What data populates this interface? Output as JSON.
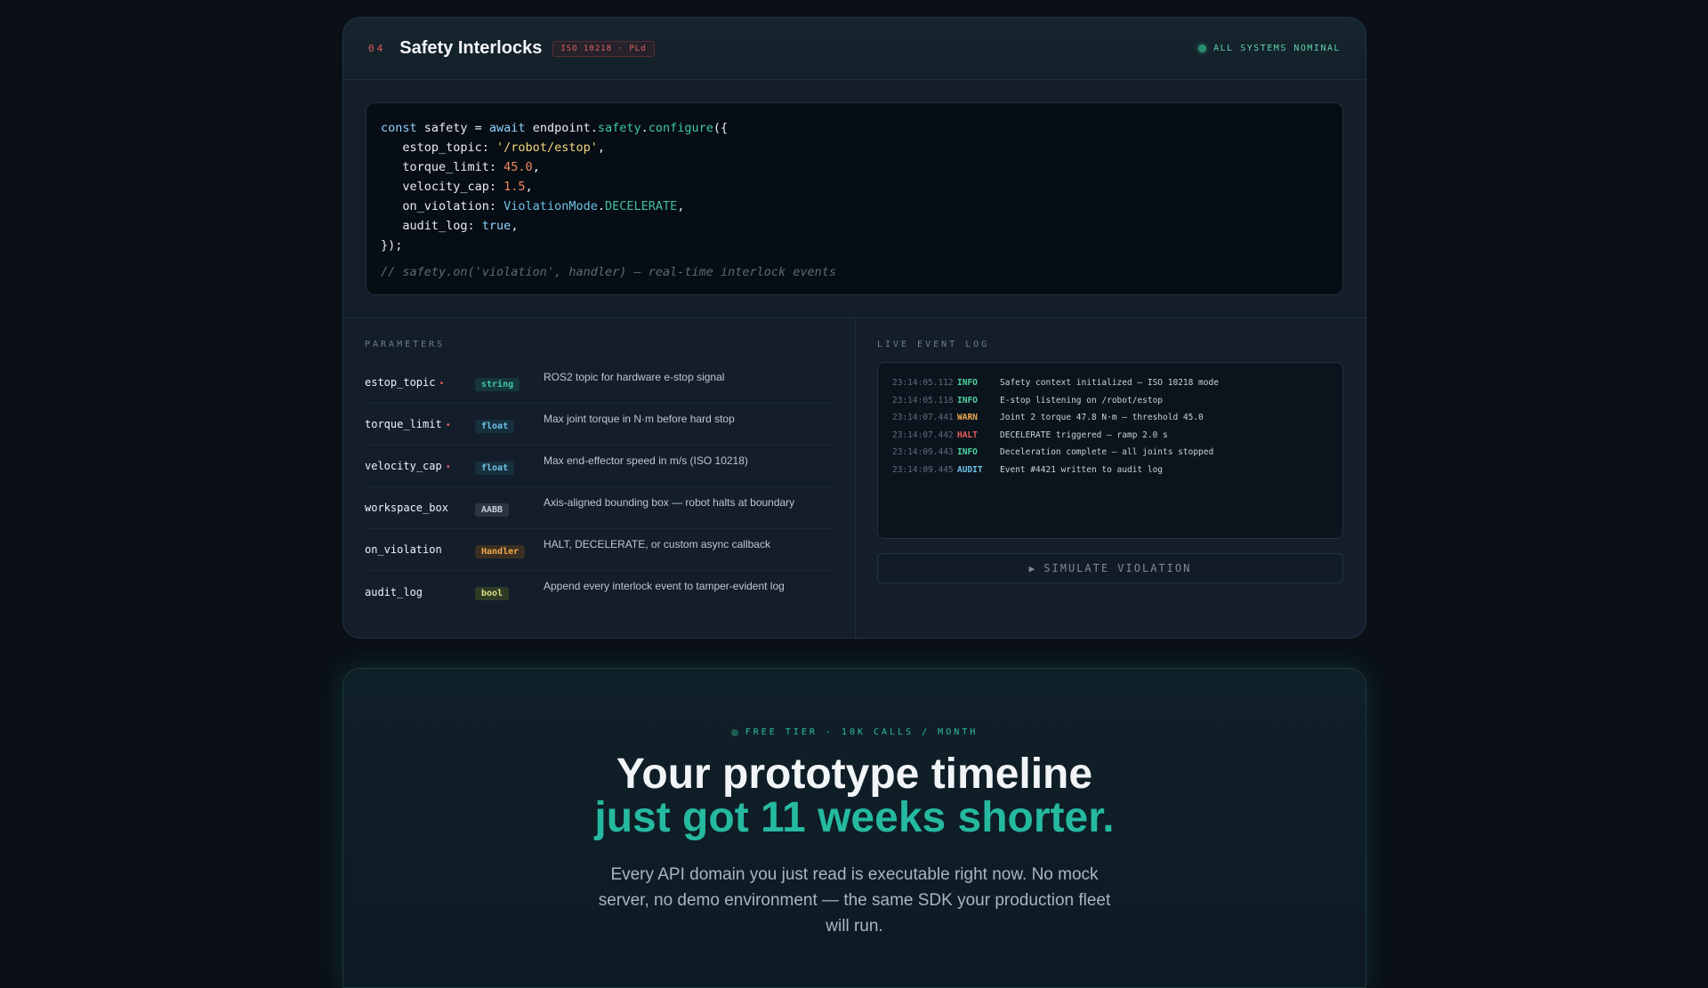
{
  "header": {
    "section_number": "04",
    "title": "Safety Interlocks",
    "badge": "ISO 10218 · PLd",
    "status": "ALL SYSTEMS NOMINAL",
    "status_color": "#2a8f6c"
  },
  "code": {
    "line1": {
      "kw": "const",
      "var": " safety = ",
      "await": "await",
      "obj": " endpoint.",
      "ns": "safety",
      "dot": ".",
      "fn": "configure",
      "tail": "({"
    },
    "line2": {
      "key": "   estop_topic: ",
      "val": "'/robot/estop'",
      "tail": ","
    },
    "line3": {
      "key": "   torque_limit: ",
      "val": "45.0",
      "tail": ","
    },
    "line4": {
      "key": "   velocity_cap: ",
      "val": "1.5",
      "tail": ","
    },
    "line5": {
      "key": "   on_violation: ",
      "cls": "ViolationMode",
      "dot": ".",
      "enm": "DECELERATE",
      "tail": ","
    },
    "line6": {
      "key": "   audit_log: ",
      "val": "true",
      "tail": ","
    },
    "line7": "});",
    "comment": "// safety.on('violation', handler) — real-time interlock events"
  },
  "parameters": {
    "label": "PARAMETERS",
    "required_marker": "•",
    "rows": [
      {
        "name": "estop_topic",
        "required": true,
        "type": "string",
        "desc": "ROS2 topic for hardware e-stop signal"
      },
      {
        "name": "torque_limit",
        "required": true,
        "type": "float",
        "desc": "Max joint torque in N·m before hard stop"
      },
      {
        "name": "velocity_cap",
        "required": true,
        "type": "float",
        "desc": "Max end-effector speed in m/s (ISO 10218)"
      },
      {
        "name": "workspace_box",
        "required": false,
        "type": "AABB",
        "desc": "Axis-aligned bounding box — robot halts at boundary"
      },
      {
        "name": "on_violation",
        "required": false,
        "type": "Handler",
        "desc": "HALT, DECELERATE, or custom async callback"
      },
      {
        "name": "audit_log",
        "required": false,
        "type": "bool",
        "desc": "Append every interlock event to tamper-evident log"
      }
    ]
  },
  "event_log": {
    "label": "LIVE EVENT LOG",
    "lines": [
      {
        "time": "23:14:05.112",
        "level": "INFO",
        "msg": "Safety context initialized — ISO 10218 mode"
      },
      {
        "time": "23:14:05.118",
        "level": "INFO",
        "msg": "E-stop listening on /robot/estop"
      },
      {
        "time": "23:14:07.441",
        "level": "WARN",
        "msg": "Joint 2 torque 47.8 N·m — threshold 45.0"
      },
      {
        "time": "23:14:07.442",
        "level": "HALT",
        "msg": "DECELERATE triggered — ramp 2.0 s"
      },
      {
        "time": "23:14:09.443",
        "level": "INFO",
        "msg": "Deceleration complete — all joints stopped"
      },
      {
        "time": "23:14:09.445",
        "level": "AUDIT",
        "msg": "Event #4421 written to audit log"
      }
    ],
    "button_label": "SIMULATE VIOLATION"
  },
  "cta": {
    "eyebrow": "FREE TIER · 10K CALLS / MONTH",
    "headline_line1": "Your prototype timeline",
    "headline_line2": "just got 11 weeks shorter.",
    "subtext": "Every API domain you just read is executable right now. No mock server, no demo environment — the same SDK your production fleet will run.",
    "accent_color": "#25b9a0"
  }
}
